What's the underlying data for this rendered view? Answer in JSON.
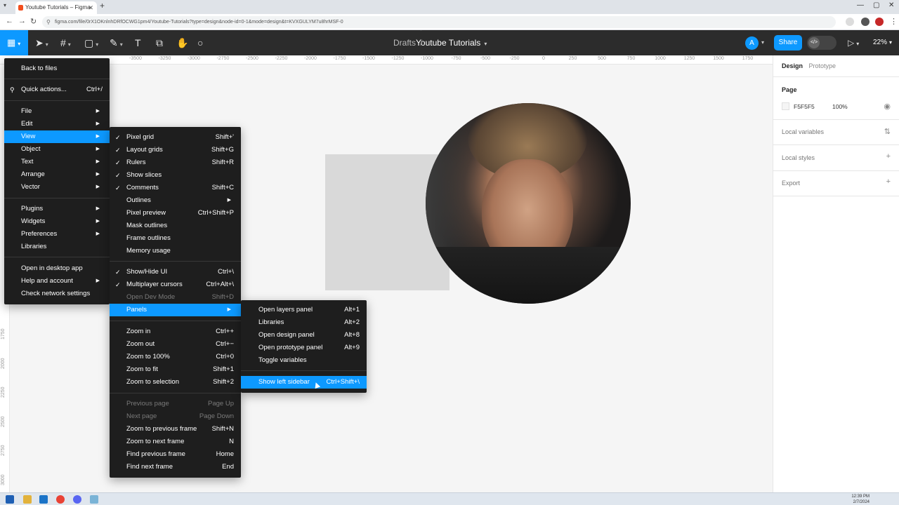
{
  "browser": {
    "tab_title": "Youtube Tutorials – Figma",
    "url": "figma.com/file/0rX1OKnlnhDRfOCWG1pm4/Youtube-Tutorials?type=design&node-id=0-1&mode=design&t=KVXGULYM7u8hrMSF-0"
  },
  "toolbar": {
    "breadcrumb_parent": "Drafts",
    "breadcrumb_separator": "/",
    "file_name": "Youtube Tutorials",
    "avatar_initial": "A",
    "share_label": "Share",
    "zoom": "22%"
  },
  "ruler": {
    "top": [
      "-3500",
      "-3250",
      "-3000",
      "-2750",
      "-2500",
      "-2250",
      "-2000",
      "-1750",
      "-1500",
      "-1250",
      "-1000",
      "-750",
      "-500",
      "-250",
      "0",
      "250",
      "500",
      "750",
      "1000",
      "1250",
      "1500",
      "1750"
    ],
    "left": [
      "1750",
      "2000",
      "2250",
      "2500",
      "2750",
      "3000"
    ]
  },
  "right_panel": {
    "tab_design": "Design",
    "tab_prototype": "Prototype",
    "page_heading": "Page",
    "page_color": "F5F5F5",
    "page_opacity": "100%",
    "local_variables": "Local variables",
    "local_styles": "Local styles",
    "export": "Export"
  },
  "main_menu": [
    {
      "label": "Back to files"
    },
    {
      "label": "Quick actions...",
      "shortcut": "Ctrl+/"
    },
    {
      "label": "File",
      "submenu": true
    },
    {
      "label": "Edit",
      "submenu": true
    },
    {
      "label": "View",
      "submenu": true,
      "highlighted": true
    },
    {
      "label": "Object",
      "submenu": true
    },
    {
      "label": "Text",
      "submenu": true
    },
    {
      "label": "Arrange",
      "submenu": true
    },
    {
      "label": "Vector",
      "submenu": true
    },
    {
      "label": "Plugins",
      "submenu": true
    },
    {
      "label": "Widgets",
      "submenu": true
    },
    {
      "label": "Preferences",
      "submenu": true
    },
    {
      "label": "Libraries"
    },
    {
      "label": "Open in desktop app"
    },
    {
      "label": "Help and account",
      "submenu": true
    },
    {
      "label": "Check network settings"
    }
  ],
  "view_menu": [
    {
      "label": "Pixel grid",
      "shortcut": "Shift+'",
      "checked": true
    },
    {
      "label": "Layout grids",
      "shortcut": "Shift+G",
      "checked": true
    },
    {
      "label": "Rulers",
      "shortcut": "Shift+R",
      "checked": true
    },
    {
      "label": "Show slices",
      "checked": true
    },
    {
      "label": "Comments",
      "shortcut": "Shift+C",
      "checked": true
    },
    {
      "label": "Outlines",
      "submenu": true
    },
    {
      "label": "Pixel preview",
      "shortcut": "Ctrl+Shift+P"
    },
    {
      "label": "Mask outlines"
    },
    {
      "label": "Frame outlines"
    },
    {
      "label": "Memory usage"
    },
    {
      "label": "Show/Hide UI",
      "shortcut": "Ctrl+\\",
      "checked": true
    },
    {
      "label": "Multiplayer cursors",
      "shortcut": "Ctrl+Alt+\\",
      "checked": true
    },
    {
      "label": "Open Dev Mode",
      "shortcut": "Shift+D",
      "disabled": true
    },
    {
      "label": "Panels",
      "submenu": true,
      "highlighted": true
    },
    {
      "label": "Zoom in",
      "shortcut": "Ctrl++"
    },
    {
      "label": "Zoom out",
      "shortcut": "Ctrl+−"
    },
    {
      "label": "Zoom to 100%",
      "shortcut": "Ctrl+0"
    },
    {
      "label": "Zoom to fit",
      "shortcut": "Shift+1"
    },
    {
      "label": "Zoom to selection",
      "shortcut": "Shift+2"
    },
    {
      "label": "Previous page",
      "shortcut": "Page Up",
      "disabled": true
    },
    {
      "label": "Next page",
      "shortcut": "Page Down",
      "disabled": true
    },
    {
      "label": "Zoom to previous frame",
      "shortcut": "Shift+N"
    },
    {
      "label": "Zoom to next frame",
      "shortcut": "N"
    },
    {
      "label": "Find previous frame",
      "shortcut": "Home"
    },
    {
      "label": "Find next frame",
      "shortcut": "End"
    }
  ],
  "panels_menu": [
    {
      "label": "Open layers panel",
      "shortcut": "Alt+1"
    },
    {
      "label": "Libraries",
      "shortcut": "Alt+2"
    },
    {
      "label": "Open design panel",
      "shortcut": "Alt+8"
    },
    {
      "label": "Open prototype panel",
      "shortcut": "Alt+9"
    },
    {
      "label": "Toggle variables"
    },
    {
      "label": "Show left sidebar",
      "shortcut": "Ctrl+Shift+\\",
      "highlighted": true
    }
  ],
  "taskbar": {
    "time": "12:39 PM",
    "date": "2/7/2024"
  },
  "colors": {
    "accent": "#0d99ff",
    "toolbar_bg": "#2c2c2c",
    "menu_bg": "#1e1e1e",
    "canvas_bg": "#f5f5f5"
  }
}
